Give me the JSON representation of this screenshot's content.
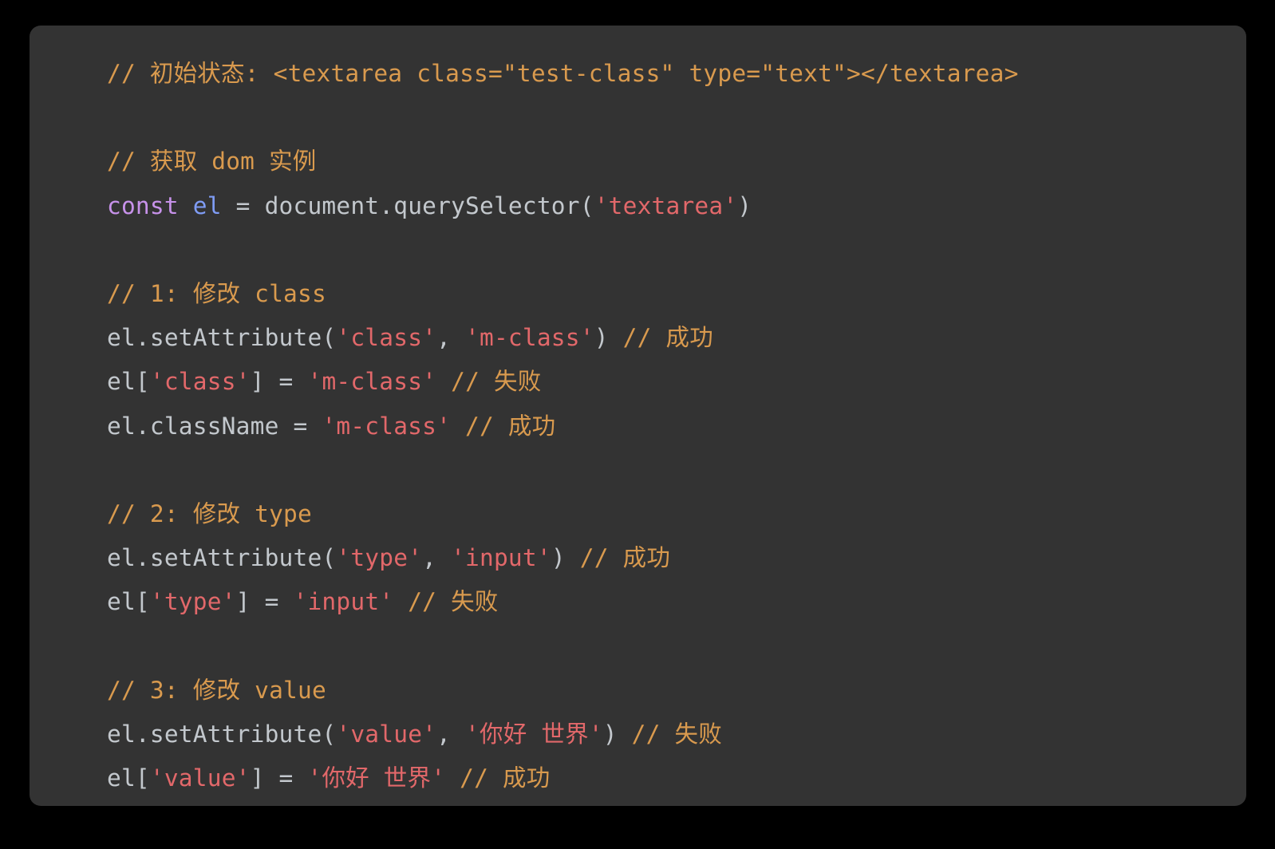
{
  "panel": {
    "background_color": "#333333",
    "page_background_color": "#000000",
    "language": "javascript"
  },
  "colors": {
    "comment": "#d99a4e",
    "plain": "#c3c8cd",
    "string": "#e2686a",
    "keyword": "#c792ea",
    "variable": "#7f9cf5",
    "punctuation": "#c3c8cd"
  },
  "code": {
    "lines": [
      {
        "index": 1,
        "text": "// 初始状态: <textarea class=\"test-class\" type=\"text\"></textarea>",
        "tokens": [
          {
            "t": "// 初始状态: <textarea class=\"test-class\" type=\"text\"></textarea>",
            "c": "comment"
          }
        ]
      },
      {
        "index": 2,
        "text": "",
        "tokens": []
      },
      {
        "index": 3,
        "text": "// 获取 dom 实例",
        "tokens": [
          {
            "t": "// 获取 dom 实例",
            "c": "comment"
          }
        ]
      },
      {
        "index": 4,
        "text": "const el = document.querySelector('textarea')",
        "tokens": [
          {
            "t": "const",
            "c": "keyword"
          },
          {
            "t": " ",
            "c": "plain"
          },
          {
            "t": "el",
            "c": "variable"
          },
          {
            "t": " = document.querySelector",
            "c": "plain"
          },
          {
            "t": "(",
            "c": "punct"
          },
          {
            "t": "'textarea'",
            "c": "string"
          },
          {
            "t": ")",
            "c": "punct"
          }
        ]
      },
      {
        "index": 5,
        "text": "",
        "tokens": []
      },
      {
        "index": 6,
        "text": "// 1: 修改 class",
        "tokens": [
          {
            "t": "// 1: 修改 class",
            "c": "comment"
          }
        ]
      },
      {
        "index": 7,
        "text": "el.setAttribute('class', 'm-class') // 成功",
        "tokens": [
          {
            "t": "el.setAttribute",
            "c": "plain"
          },
          {
            "t": "(",
            "c": "punct"
          },
          {
            "t": "'class'",
            "c": "string"
          },
          {
            "t": ", ",
            "c": "plain"
          },
          {
            "t": "'m-class'",
            "c": "string"
          },
          {
            "t": ")",
            "c": "punct"
          },
          {
            "t": " ",
            "c": "plain"
          },
          {
            "t": "// 成功",
            "c": "comment"
          }
        ]
      },
      {
        "index": 8,
        "text": "el['class'] = 'm-class' // 失败",
        "tokens": [
          {
            "t": "el",
            "c": "plain"
          },
          {
            "t": "[",
            "c": "punct"
          },
          {
            "t": "'class'",
            "c": "string"
          },
          {
            "t": "]",
            "c": "punct"
          },
          {
            "t": " = ",
            "c": "plain"
          },
          {
            "t": "'m-class'",
            "c": "string"
          },
          {
            "t": " ",
            "c": "plain"
          },
          {
            "t": "// 失败",
            "c": "comment"
          }
        ]
      },
      {
        "index": 9,
        "text": "el.className = 'm-class' // 成功",
        "tokens": [
          {
            "t": "el.className = ",
            "c": "plain"
          },
          {
            "t": "'m-class'",
            "c": "string"
          },
          {
            "t": " ",
            "c": "plain"
          },
          {
            "t": "// 成功",
            "c": "comment"
          }
        ]
      },
      {
        "index": 10,
        "text": "",
        "tokens": []
      },
      {
        "index": 11,
        "text": "// 2: 修改 type",
        "tokens": [
          {
            "t": "// 2: 修改 type",
            "c": "comment"
          }
        ]
      },
      {
        "index": 12,
        "text": "el.setAttribute('type', 'input') // 成功",
        "tokens": [
          {
            "t": "el.setAttribute",
            "c": "plain"
          },
          {
            "t": "(",
            "c": "punct"
          },
          {
            "t": "'type'",
            "c": "string"
          },
          {
            "t": ", ",
            "c": "plain"
          },
          {
            "t": "'input'",
            "c": "string"
          },
          {
            "t": ")",
            "c": "punct"
          },
          {
            "t": " ",
            "c": "plain"
          },
          {
            "t": "// 成功",
            "c": "comment"
          }
        ]
      },
      {
        "index": 13,
        "text": "el['type'] = 'input' // 失败",
        "tokens": [
          {
            "t": "el",
            "c": "plain"
          },
          {
            "t": "[",
            "c": "punct"
          },
          {
            "t": "'type'",
            "c": "string"
          },
          {
            "t": "]",
            "c": "punct"
          },
          {
            "t": " = ",
            "c": "plain"
          },
          {
            "t": "'input'",
            "c": "string"
          },
          {
            "t": " ",
            "c": "plain"
          },
          {
            "t": "// 失败",
            "c": "comment"
          }
        ]
      },
      {
        "index": 14,
        "text": "",
        "tokens": []
      },
      {
        "index": 15,
        "text": "// 3: 修改 value",
        "tokens": [
          {
            "t": "// 3: 修改 value",
            "c": "comment"
          }
        ]
      },
      {
        "index": 16,
        "text": "el.setAttribute('value', '你好 世界') // 失败",
        "tokens": [
          {
            "t": "el.setAttribute",
            "c": "plain"
          },
          {
            "t": "(",
            "c": "punct"
          },
          {
            "t": "'value'",
            "c": "string"
          },
          {
            "t": ", ",
            "c": "plain"
          },
          {
            "t": "'你好 世界'",
            "c": "string"
          },
          {
            "t": ")",
            "c": "punct"
          },
          {
            "t": " ",
            "c": "plain"
          },
          {
            "t": "// 失败",
            "c": "comment"
          }
        ]
      },
      {
        "index": 17,
        "text": "el['value'] = '你好 世界' // 成功",
        "tokens": [
          {
            "t": "el",
            "c": "plain"
          },
          {
            "t": "[",
            "c": "punct"
          },
          {
            "t": "'value'",
            "c": "string"
          },
          {
            "t": "]",
            "c": "punct"
          },
          {
            "t": " = ",
            "c": "plain"
          },
          {
            "t": "'你好 世界'",
            "c": "string"
          },
          {
            "t": " ",
            "c": "plain"
          },
          {
            "t": "// 成功",
            "c": "comment"
          }
        ]
      }
    ]
  }
}
